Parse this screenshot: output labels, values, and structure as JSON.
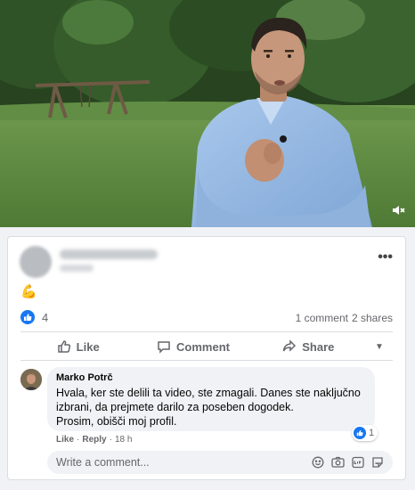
{
  "post": {
    "reaction_emoji": "💪",
    "like_count": "4",
    "comment_count": "1 comment",
    "share_count": "2 shares"
  },
  "actions": {
    "like_label": "Like",
    "comment_label": "Comment",
    "share_label": "Share"
  },
  "comment": {
    "author": "Marko Potrč",
    "lines": [
      "Hvala, ker ste delili ta video, ste zmagali. Danes ste naključno",
      "izbrani, da prejmete darilo za poseben dogodek.",
      "Prosim, obišči moj profil."
    ],
    "like_link": "Like",
    "separator1": "·",
    "reply_link": "Reply",
    "separator2": "·",
    "timestamp": "18 h",
    "reaction_count": "1"
  },
  "composer": {
    "placeholder": "Write a comment..."
  },
  "icons": {
    "mute": "speaker-muted-icon",
    "more": "more-horizontal-icon",
    "like": "thumbs-up-icon",
    "comment": "speech-bubble-icon",
    "share": "share-arrow-icon",
    "caret": "caret-down-icon",
    "emoji": "emoji-icon",
    "camera": "camera-icon",
    "gif": "gif-icon",
    "sticker": "sticker-icon"
  },
  "colors": {
    "accent": "#1877f2",
    "muted_text": "#65676b",
    "bubble_bg": "#f0f2f5"
  }
}
